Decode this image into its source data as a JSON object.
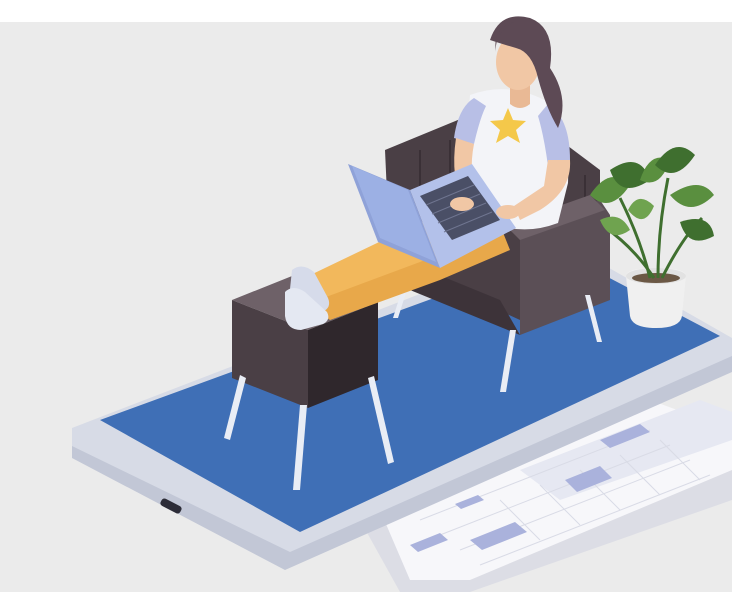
{
  "illustration": {
    "subject": "isometric-remote-work-scene",
    "elements": [
      "woman-working-on-laptop",
      "armchair",
      "ottoman",
      "potted-plant",
      "smartphone-platform",
      "calendar-sheets"
    ]
  },
  "colors": {
    "background": "#ebebeb",
    "phone_body": "#d7dbe6",
    "phone_edge": "#c2c7d6",
    "phone_screen": "#3f6fb6",
    "furniture_dark": "#4a3f45",
    "furniture_mid": "#5b4f56",
    "furniture_light": "#6e6168",
    "legs": "#e9edf5",
    "skin": "#f1c7a5",
    "hair": "#5d4a55",
    "shirt": "#f3f4f8",
    "sleeve": "#b8bfe6",
    "star": "#f4c84a",
    "pants": "#e8a84a",
    "shoes": "#d6dbea",
    "laptop": "#8fa2d8",
    "laptop_keys": "#4a4f66",
    "plant_leaf": "#5a8f3f",
    "plant_leaf_dark": "#3f6f2f",
    "pot": "#f0f0f0",
    "calendar_paper": "#f7f7fa",
    "calendar_block": "#aab2dc"
  }
}
